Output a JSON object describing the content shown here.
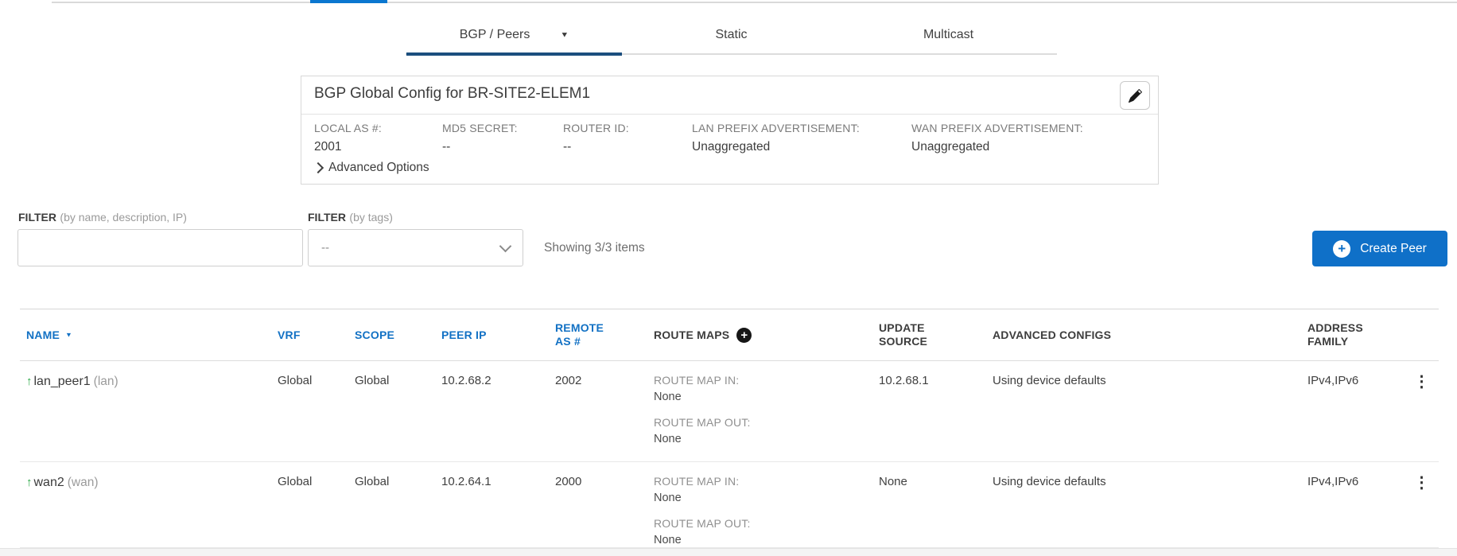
{
  "colors": {
    "accent_blue": "#1271c4",
    "active_tab_underline": "#1b4e7e",
    "top_indicator_blue": "#0b77d0",
    "button_blue": "#0f70c8",
    "green_arrow": "#27a744"
  },
  "icons": {
    "caret_down": "▼",
    "arrow_up": "↑",
    "kebab": "⋮",
    "plus": "+"
  },
  "tabs": {
    "items": [
      {
        "label": "BGP / Peers",
        "active": true,
        "has_dropdown": true
      },
      {
        "label": "Static",
        "active": false
      },
      {
        "label": "Multicast",
        "active": false
      }
    ]
  },
  "config_card": {
    "title": "BGP Global Config for BR-SITE2-ELEM1",
    "fields": [
      {
        "label": "LOCAL AS #:",
        "value": "2001"
      },
      {
        "label": "MD5 SECRET:",
        "value": "--"
      },
      {
        "label": "ROUTER ID:",
        "value": "--"
      },
      {
        "label": "LAN PREFIX ADVERTISEMENT:",
        "value": "Unaggregated"
      },
      {
        "label": "WAN PREFIX ADVERTISEMENT:",
        "value": "Unaggregated"
      }
    ],
    "advanced_options_label": "Advanced Options"
  },
  "filters": {
    "name_filter": {
      "label": "FILTER",
      "hint": "(by name, description, IP)",
      "value": "",
      "placeholder": ""
    },
    "tag_filter": {
      "label": "FILTER",
      "hint": "(by tags)",
      "selected_value": "--"
    },
    "showing_text": "Showing 3/3 items",
    "create_button_label": "Create Peer"
  },
  "table": {
    "columns": [
      {
        "label": "NAME",
        "sortable": true,
        "sort": "desc"
      },
      {
        "label": "VRF",
        "sortable": true
      },
      {
        "label": "SCOPE",
        "sortable": true
      },
      {
        "label": "PEER IP",
        "sortable": true
      },
      {
        "label": "REMOTE AS #",
        "sortable": true
      },
      {
        "label": "ROUTE MAPS",
        "has_add_button": true
      },
      {
        "label": "UPDATE SOURCE"
      },
      {
        "label": "ADVANCED CONFIGS"
      },
      {
        "label": "ADDRESS FAMILY"
      }
    ],
    "route_map_in_label": "ROUTE MAP IN:",
    "route_map_out_label": "ROUTE MAP OUT:",
    "rows": [
      {
        "name": "lan_peer1",
        "name_suffix": "(lan)",
        "vrf": "Global",
        "scope": "Global",
        "peer_ip": "10.2.68.2",
        "remote_as": "2002",
        "route_map_in": "None",
        "route_map_out": "None",
        "update_source": "10.2.68.1",
        "advanced_configs": "Using device defaults",
        "address_family": "IPv4,IPv6"
      },
      {
        "name": "wan2",
        "name_suffix": "(wan)",
        "vrf": "Global",
        "scope": "Global",
        "peer_ip": "10.2.64.1",
        "remote_as": "2000",
        "route_map_in": "None",
        "route_map_out": "None",
        "update_source": "None",
        "advanced_configs": "Using device defaults",
        "address_family": "IPv4,IPv6"
      }
    ]
  }
}
